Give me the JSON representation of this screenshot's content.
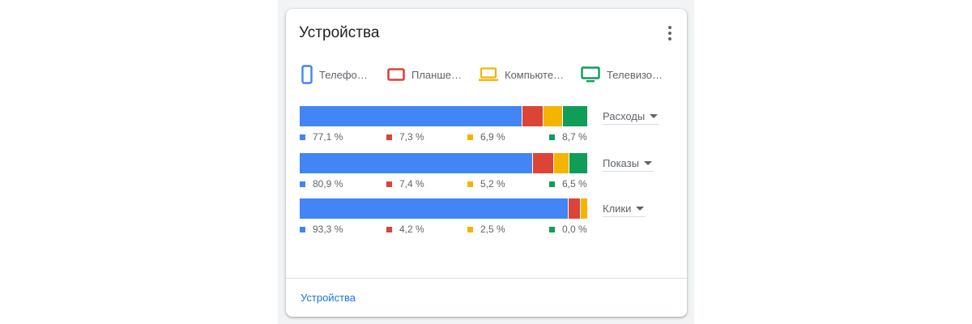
{
  "card": {
    "title": "Устройства",
    "footer_link": "Устройства"
  },
  "colors": {
    "phone": "#4285f4",
    "tablet": "#db4437",
    "computer": "#f4b400",
    "tv": "#0f9d58"
  },
  "legend": [
    {
      "icon": "phone-icon",
      "label": "Телефо…",
      "color_key": "phone"
    },
    {
      "icon": "tablet-icon",
      "label": "Планше…",
      "color_key": "tablet"
    },
    {
      "icon": "computer-icon",
      "label": "Компьюте…",
      "color_key": "computer"
    },
    {
      "icon": "tv-icon",
      "label": "Телевизо…",
      "color_key": "tv"
    }
  ],
  "metrics": [
    {
      "select_label": "Расходы",
      "values": [
        77.1,
        7.3,
        6.9,
        8.7
      ],
      "labels": [
        "77,1 %",
        "7,3 %",
        "6,9 %",
        "8,7 %"
      ]
    },
    {
      "select_label": "Показы",
      "values": [
        80.9,
        7.4,
        5.2,
        6.5
      ],
      "labels": [
        "80,9 %",
        "7,4 %",
        "5,2 %",
        "6,5 %"
      ]
    },
    {
      "select_label": "Клики",
      "values": [
        93.3,
        4.2,
        2.5,
        0.0
      ],
      "labels": [
        "93,3 %",
        "4,2 %",
        "2,5 %",
        "0,0 %"
      ]
    }
  ]
}
